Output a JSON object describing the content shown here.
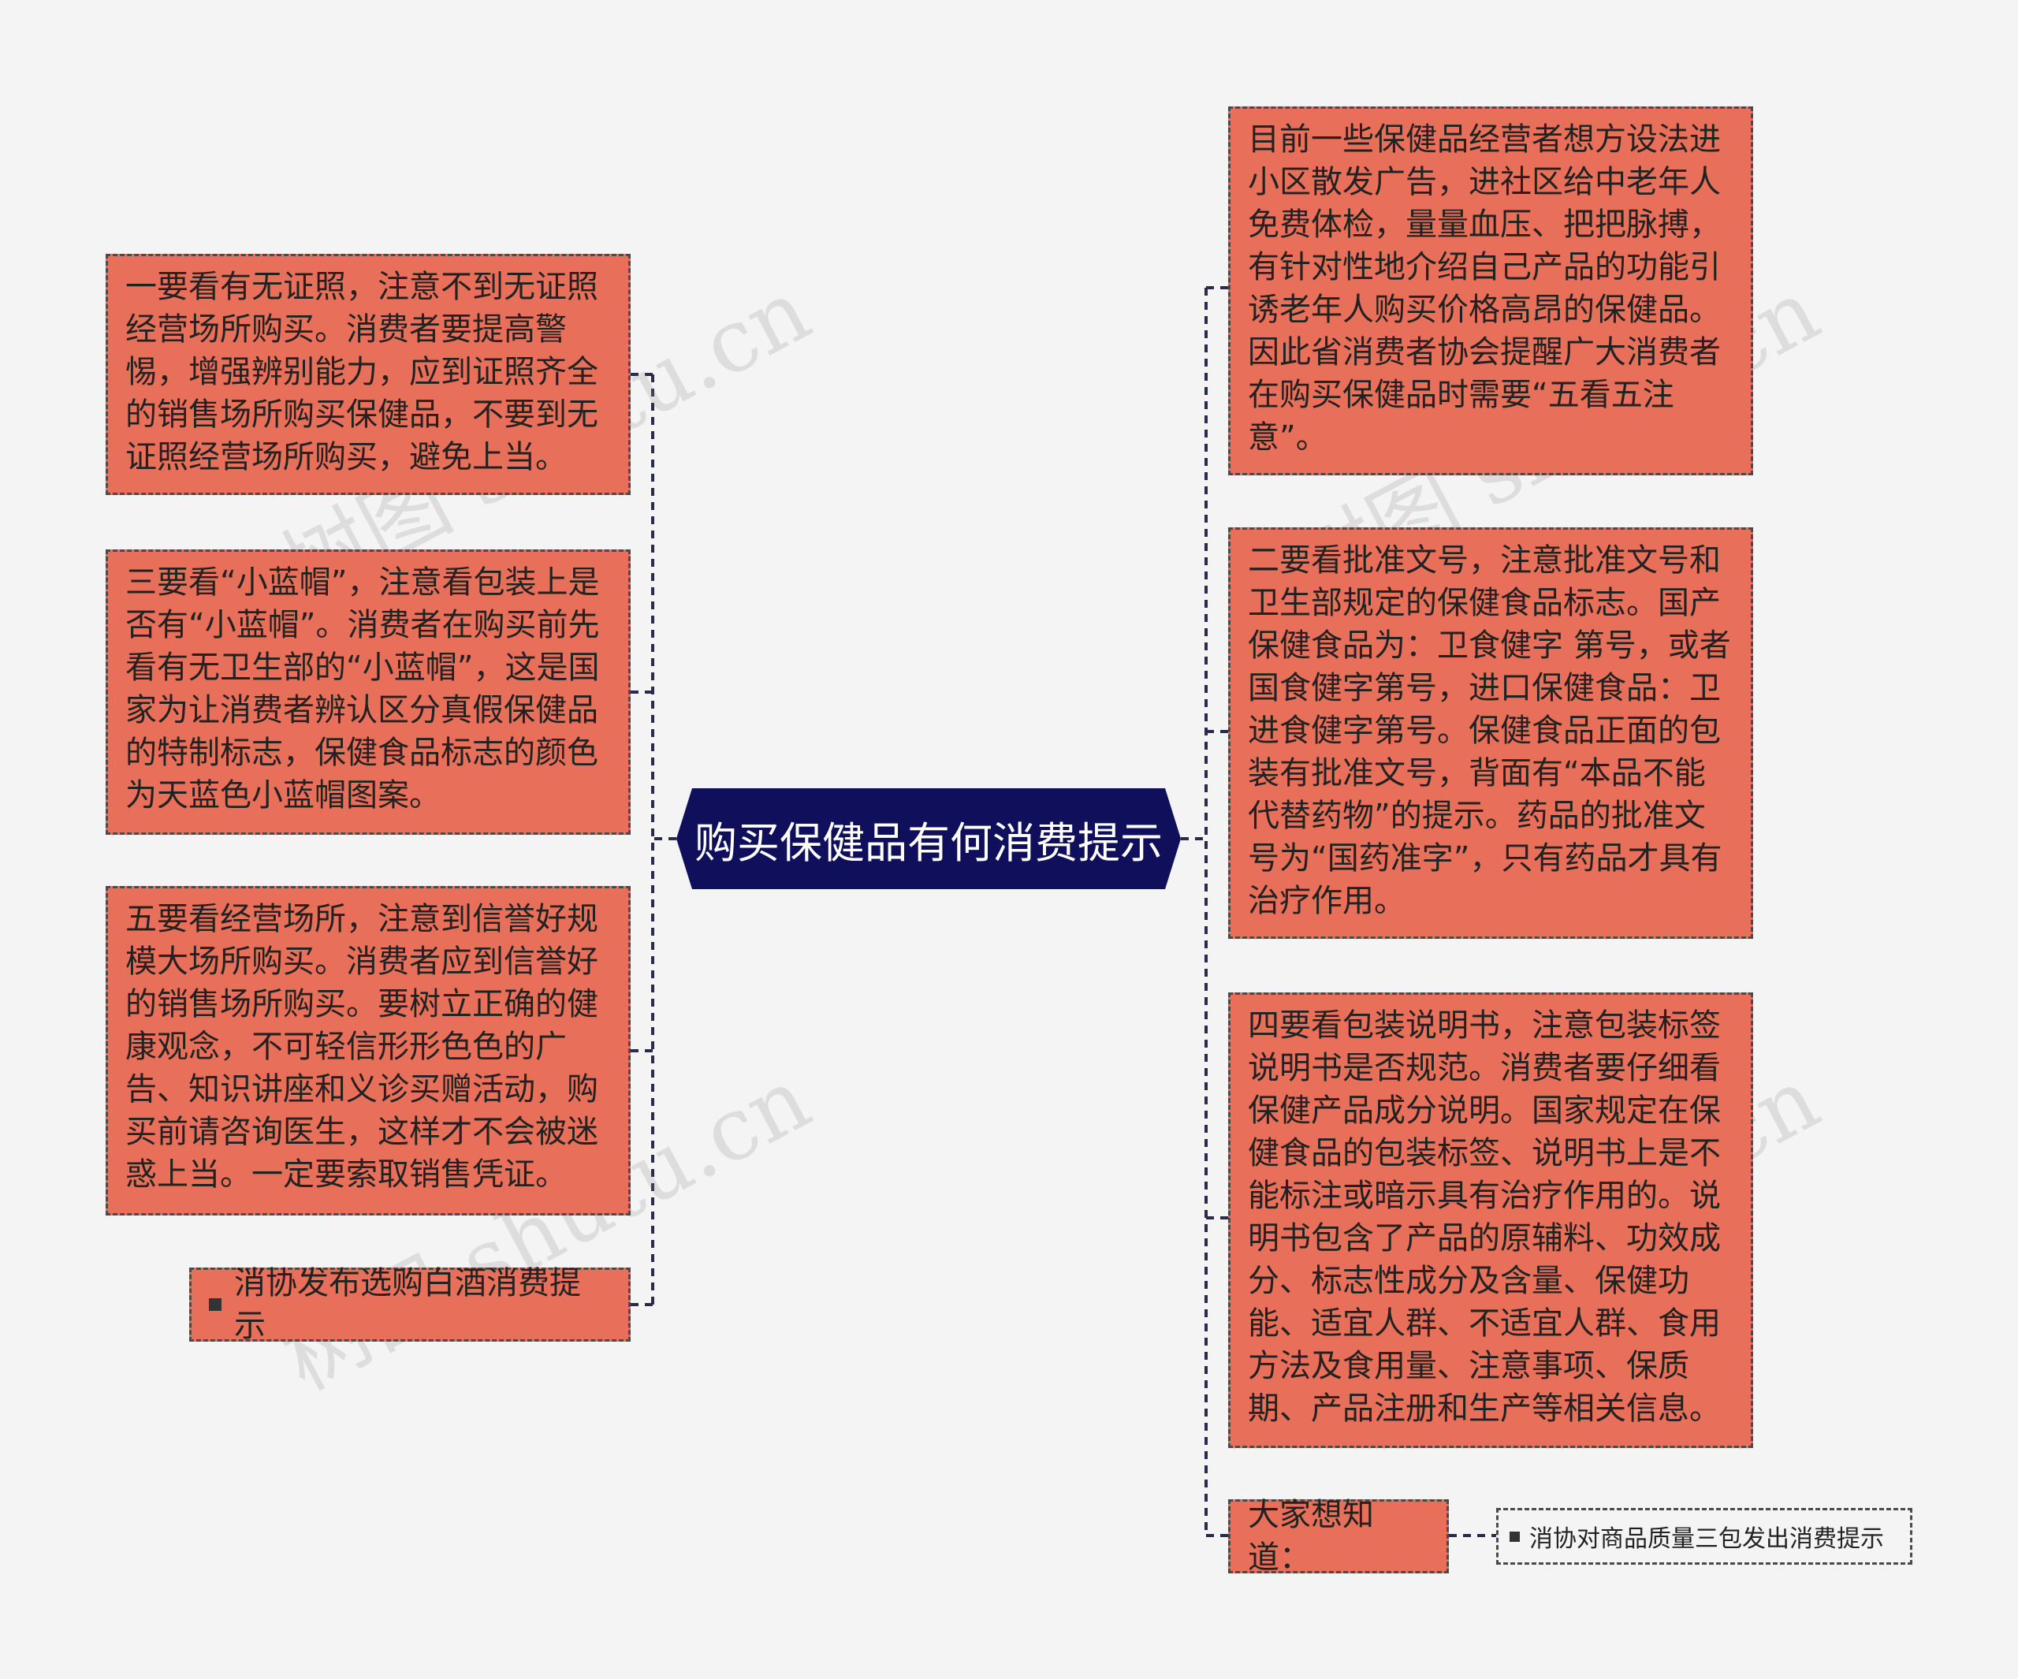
{
  "center": {
    "title": "购买保健品有何消费提示"
  },
  "left_nodes": [
    {
      "text": "一要看有无证照，注意不到无证照经营场所购买。消费者要提高警惕，增强辨别能力，应到证照齐全的销售场所购买保健品，不要到无证照经营场所购买，避免上当。"
    },
    {
      "text": "三要看“小蓝帽”，注意看包装上是否有“小蓝帽”。消费者在购买前先看有无卫生部的“小蓝帽”，这是国家为让消费者辨认区分真假保健品的特制标志，保健食品标志的颜色为天蓝色小蓝帽图案。"
    },
    {
      "text": "五要看经营场所，注意到信誉好规模大场所购买。消费者应到信誉好的销售场所购买。要树立正确的健康观念，不可轻信形形色色的广告、知识讲座和义诊买赠活动，购买前请咨询医生，这样才不会被迷惑上当。一定要索取销售凭证。"
    },
    {
      "text": "消协发布选购白酒消费提示"
    }
  ],
  "right_nodes": [
    {
      "text": "目前一些保健品经营者想方设法进小区散发广告，进社区给中老年人免费体检，量量血压、把把脉搏，有针对性地介绍自己产品的功能引诱老年人购买价格高昂的保健品。因此省消费者协会提醒广大消费者在购买保健品时需要“五看五注意”。"
    },
    {
      "text": "二要看批准文号，注意批准文号和卫生部规定的保健食品标志。国产保健食品为：卫食健字 第号，或者国食健字第号，进口保健食品：卫进食健字第号。保健食品正面的包装有批准文号，背面有“本品不能代替药物”的提示。药品的批准文号为“国药准字”，只有药品才具有治疗作用。"
    },
    {
      "text": "四要看包装说明书，注意包装标签说明书是否规范。消费者要仔细看保健产品成分说明。国家规定在保健食品的包装标签、说明书上是不能标注或暗示具有治疗作用的。说明书包含了产品的原辅料、功效成分、标志性成分及含量、保健功能、适宜人群、不适宜人群、食用方法及食用量、注意事项、保质期、产品注册和生产等相关信息。"
    },
    {
      "text": "大家想知道："
    }
  ],
  "related": {
    "text": "消协对商品质量三包发出消费提示"
  },
  "watermark": "树图 shutu.cn",
  "colors": {
    "node": "#e8705a",
    "center": "#0f0f5c",
    "background": "#f4f4f4"
  }
}
